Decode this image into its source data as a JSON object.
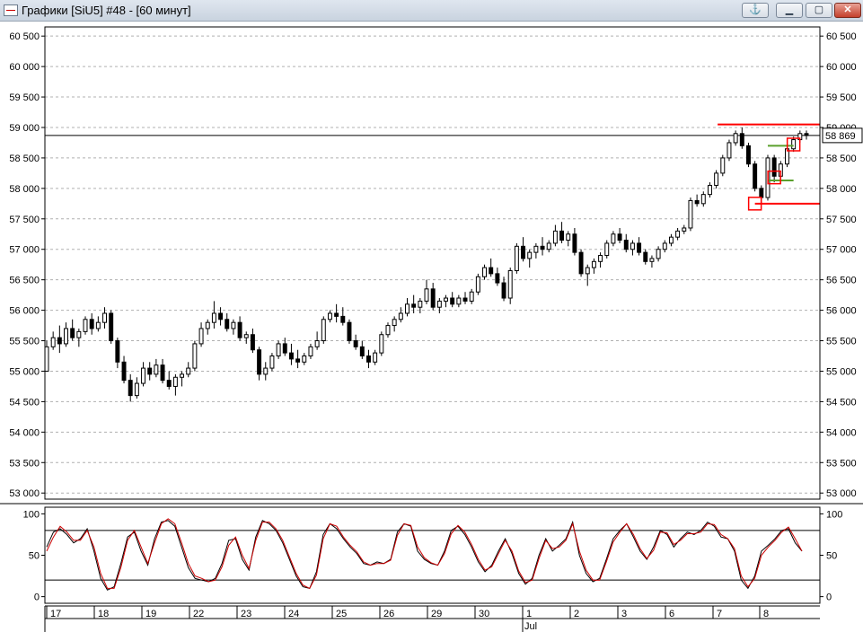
{
  "window": {
    "title": "Графики [SiU5] #48 - [60 минут]",
    "anchor_icon": "anchor-icon",
    "minimize_icon": "minimize-icon",
    "maximize_icon": "maximize-icon",
    "close_icon": "close-icon"
  },
  "chart_data": [
    {
      "type": "candlestick",
      "ylim": [
        52900,
        60650
      ],
      "y_ticks": [
        "60 500",
        "60 000",
        "59 500",
        "59 000",
        "58 500",
        "58 000",
        "57 500",
        "57 000",
        "56 500",
        "56 000",
        "55 500",
        "55 000",
        "54 500",
        "54 000",
        "53 500",
        "53 000"
      ],
      "y_tick_values": [
        60500,
        60000,
        59500,
        59000,
        58500,
        58000,
        57500,
        57000,
        56500,
        56000,
        55500,
        55000,
        54500,
        54000,
        53500,
        53000
      ],
      "grid": "horizontal-dashed",
      "last_price": 58869,
      "last_price_label": "58 869",
      "candles": [
        [
          55000,
          55500,
          55100,
          55400
        ],
        [
          55400,
          55650,
          55350,
          55550
        ],
        [
          55550,
          55750,
          55300,
          55450
        ],
        [
          55450,
          55800,
          55400,
          55700
        ],
        [
          55700,
          55850,
          55500,
          55550
        ],
        [
          55550,
          55700,
          55400,
          55650
        ],
        [
          55650,
          55900,
          55600,
          55850
        ],
        [
          55850,
          55950,
          55600,
          55700
        ],
        [
          55700,
          55900,
          55650,
          55800
        ],
        [
          55800,
          56050,
          55700,
          55950
        ],
        [
          55950,
          56000,
          55450,
          55500
        ],
        [
          55500,
          55550,
          55050,
          55150
        ],
        [
          55150,
          55250,
          54800,
          54850
        ],
        [
          54850,
          54950,
          54500,
          54600
        ],
        [
          54600,
          54900,
          54550,
          54800
        ],
        [
          54800,
          55150,
          54750,
          55050
        ],
        [
          55050,
          55150,
          54850,
          54950
        ],
        [
          54950,
          55200,
          54900,
          55100
        ],
        [
          55100,
          55200,
          54800,
          54850
        ],
        [
          54850,
          55000,
          54700,
          54750
        ],
        [
          54750,
          54950,
          54600,
          54900
        ],
        [
          54900,
          55000,
          54750,
          54950
        ],
        [
          54950,
          55150,
          54900,
          55050
        ],
        [
          55050,
          55500,
          55000,
          55450
        ],
        [
          55450,
          55800,
          55400,
          55700
        ],
        [
          55700,
          55850,
          55600,
          55800
        ],
        [
          55800,
          56150,
          55700,
          55950
        ],
        [
          55950,
          56050,
          55750,
          55850
        ],
        [
          55850,
          55950,
          55650,
          55700
        ],
        [
          55700,
          55850,
          55600,
          55800
        ],
        [
          55800,
          55900,
          55500,
          55550
        ],
        [
          55550,
          55650,
          55450,
          55600
        ],
        [
          55600,
          55700,
          55300,
          55350
        ],
        [
          55350,
          55400,
          54850,
          54950
        ],
        [
          54950,
          55150,
          54850,
          55050
        ],
        [
          55050,
          55300,
          55000,
          55250
        ],
        [
          55250,
          55500,
          55200,
          55450
        ],
        [
          55450,
          55550,
          55250,
          55300
        ],
        [
          55300,
          55450,
          55100,
          55200
        ],
        [
          55200,
          55350,
          55050,
          55150
        ],
        [
          55150,
          55300,
          55100,
          55250
        ],
        [
          55250,
          55450,
          55200,
          55400
        ],
        [
          55400,
          55650,
          55350,
          55500
        ],
        [
          55500,
          55900,
          55450,
          55850
        ],
        [
          55850,
          56000,
          55800,
          55950
        ],
        [
          55950,
          56100,
          55800,
          55900
        ],
        [
          55900,
          56050,
          55750,
          55800
        ],
        [
          55800,
          55850,
          55450,
          55500
        ],
        [
          55500,
          55600,
          55350,
          55400
        ],
        [
          55400,
          55500,
          55200,
          55250
        ],
        [
          55250,
          55350,
          55050,
          55150
        ],
        [
          55150,
          55350,
          55100,
          55300
        ],
        [
          55300,
          55650,
          55250,
          55600
        ],
        [
          55600,
          55800,
          55550,
          55750
        ],
        [
          55750,
          55900,
          55650,
          55850
        ],
        [
          55850,
          56050,
          55800,
          55950
        ],
        [
          55950,
          56200,
          55900,
          56100
        ],
        [
          56100,
          56250,
          55950,
          56050
        ],
        [
          56050,
          56200,
          55950,
          56150
        ],
        [
          56150,
          56500,
          56100,
          56350
        ],
        [
          56350,
          56450,
          56000,
          56050
        ],
        [
          56050,
          56200,
          55950,
          56150
        ],
        [
          56150,
          56250,
          56050,
          56200
        ],
        [
          56200,
          56300,
          56050,
          56100
        ],
        [
          56100,
          56250,
          56050,
          56200
        ],
        [
          56200,
          56300,
          56100,
          56150
        ],
        [
          56150,
          56350,
          56100,
          56300
        ],
        [
          56300,
          56600,
          56250,
          56550
        ],
        [
          56550,
          56750,
          56500,
          56700
        ],
        [
          56700,
          56850,
          56550,
          56600
        ],
        [
          56600,
          56700,
          56400,
          56450
        ],
        [
          56450,
          56550,
          56150,
          56200
        ],
        [
          56200,
          56700,
          56100,
          56650
        ],
        [
          56650,
          57100,
          56600,
          57050
        ],
        [
          57050,
          57200,
          56800,
          56850
        ],
        [
          56850,
          57000,
          56700,
          56950
        ],
        [
          56950,
          57100,
          56850,
          57050
        ],
        [
          57050,
          57200,
          56900,
          57000
        ],
        [
          57000,
          57150,
          56950,
          57100
        ],
        [
          57100,
          57400,
          57050,
          57300
        ],
        [
          57300,
          57450,
          57100,
          57150
        ],
        [
          57150,
          57300,
          57050,
          57250
        ],
        [
          57250,
          57350,
          56900,
          56950
        ],
        [
          56950,
          57000,
          56550,
          56600
        ],
        [
          56600,
          56750,
          56400,
          56700
        ],
        [
          56700,
          56850,
          56600,
          56800
        ],
        [
          56800,
          56950,
          56700,
          56900
        ],
        [
          56900,
          57150,
          56850,
          57100
        ],
        [
          57100,
          57300,
          57050,
          57250
        ],
        [
          57250,
          57350,
          57100,
          57150
        ],
        [
          57150,
          57250,
          56950,
          57000
        ],
        [
          57000,
          57150,
          56900,
          57100
        ],
        [
          57100,
          57200,
          56900,
          56950
        ],
        [
          56950,
          57000,
          56750,
          56800
        ],
        [
          56800,
          56900,
          56700,
          56850
        ],
        [
          56850,
          57050,
          56800,
          57000
        ],
        [
          57000,
          57150,
          56950,
          57100
        ],
        [
          57100,
          57250,
          57050,
          57200
        ],
        [
          57200,
          57350,
          57150,
          57300
        ],
        [
          57300,
          57400,
          57250,
          57350
        ],
        [
          57350,
          57850,
          57300,
          57800
        ],
        [
          57800,
          57900,
          57700,
          57750
        ],
        [
          57750,
          57950,
          57700,
          57900
        ],
        [
          57900,
          58100,
          57850,
          58050
        ],
        [
          58050,
          58300,
          58000,
          58250
        ],
        [
          58250,
          58550,
          58200,
          58500
        ],
        [
          58500,
          58800,
          58450,
          58750
        ],
        [
          58750,
          58950,
          58700,
          58900
        ],
        [
          58900,
          59000,
          58650,
          58700
        ],
        [
          58700,
          58750,
          58350,
          58400
        ],
        [
          58400,
          58450,
          57950,
          58000
        ],
        [
          58000,
          58050,
          57750,
          57850
        ],
        [
          57850,
          58550,
          57800,
          58500
        ],
        [
          58500,
          58550,
          58100,
          58200
        ],
        [
          58200,
          58450,
          58150,
          58400
        ],
        [
          58400,
          58700,
          58350,
          58650
        ],
        [
          58650,
          58850,
          58600,
          58800
        ],
        [
          58800,
          58950,
          58750,
          58900
        ],
        [
          58900,
          58950,
          58800,
          58869
        ]
      ],
      "levels": [
        {
          "value": 59050,
          "color": "#ff0000"
        },
        {
          "value": 57750,
          "color": "#ff0000"
        }
      ],
      "colors": {
        "candle": "#000000",
        "level": "#ff0000",
        "marker": "#ff0000",
        "green_level": "#5aa02c",
        "price_line": "#000000"
      }
    },
    {
      "type": "line",
      "ylim": [
        -8,
        108
      ],
      "y_ticks": [
        "100",
        "50",
        "0"
      ],
      "y_tick_values": [
        100,
        50,
        0
      ],
      "h_lines": [
        80,
        20
      ],
      "series": [
        {
          "color": "#000000",
          "values": [
            60,
            78,
            82,
            75,
            65,
            70,
            82,
            55,
            22,
            8,
            12,
            40,
            72,
            78,
            55,
            38,
            70,
            90,
            92,
            85,
            60,
            35,
            22,
            20,
            18,
            22,
            40,
            68,
            70,
            45,
            32,
            72,
            92,
            88,
            80,
            65,
            45,
            25,
            12,
            10,
            30,
            75,
            88,
            82,
            70,
            60,
            52,
            40,
            38,
            42,
            40,
            45,
            78,
            88,
            85,
            55,
            45,
            40,
            38,
            55,
            80,
            85,
            75,
            60,
            42,
            30,
            38,
            55,
            70,
            52,
            28,
            15,
            22,
            50,
            70,
            55,
            62,
            70,
            90,
            50,
            28,
            18,
            22,
            45,
            70,
            80,
            88,
            72,
            55,
            45,
            60,
            80,
            75,
            60,
            70,
            78,
            75,
            80,
            90,
            85,
            72,
            70,
            55,
            20,
            10,
            25,
            55,
            62,
            70,
            80,
            82,
            65,
            55
          ]
        },
        {
          "color": "#cc0000",
          "values": [
            55,
            72,
            85,
            78,
            68,
            68,
            80,
            60,
            28,
            10,
            10,
            35,
            68,
            80,
            60,
            40,
            65,
            88,
            94,
            88,
            65,
            40,
            25,
            22,
            18,
            20,
            36,
            62,
            72,
            50,
            34,
            68,
            90,
            90,
            82,
            68,
            48,
            28,
            14,
            10,
            26,
            70,
            88,
            85,
            72,
            62,
            54,
            42,
            38,
            40,
            40,
            44,
            74,
            88,
            86,
            60,
            47,
            41,
            38,
            52,
            76,
            86,
            78,
            63,
            45,
            32,
            36,
            52,
            68,
            55,
            31,
            17,
            20,
            46,
            68,
            58,
            60,
            68,
            88,
            55,
            32,
            20,
            20,
            42,
            66,
            78,
            88,
            75,
            58,
            46,
            56,
            78,
            77,
            63,
            68,
            76,
            76,
            78,
            88,
            87,
            75,
            70,
            58,
            25,
            12,
            22,
            50,
            60,
            68,
            78,
            84,
            70,
            55
          ]
        }
      ]
    }
  ],
  "x_axis": {
    "day_labels": [
      "17",
      "18",
      "19",
      "22",
      "23",
      "24",
      "25",
      "26",
      "29",
      "30",
      "1",
      "2",
      "3",
      "6",
      "7",
      "8"
    ],
    "month_label": "Jul"
  }
}
